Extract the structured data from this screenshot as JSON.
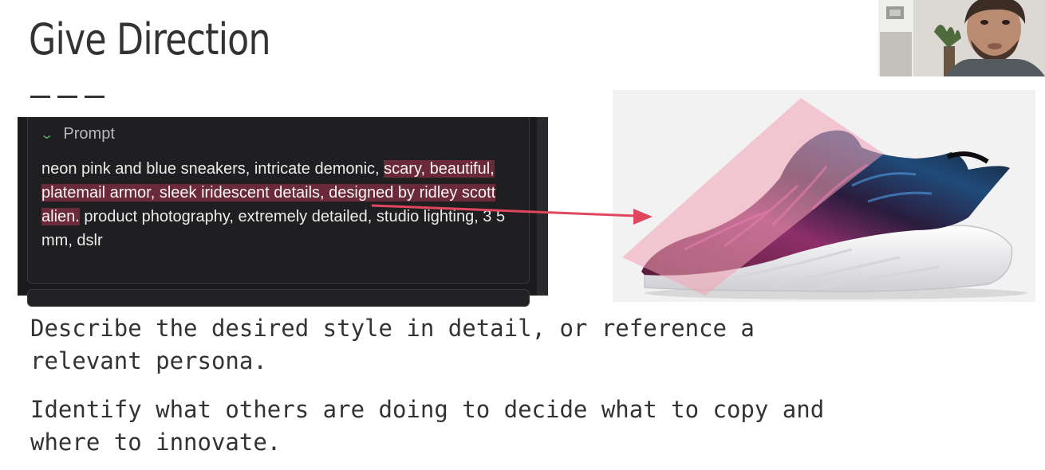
{
  "slide": {
    "title": "Give Direction"
  },
  "prompt_panel": {
    "header_label": "Prompt",
    "text_before": "neon pink and blue sneakers, intricate demonic, ",
    "text_highlighted": "scary, beautiful, platemail armor, sleek iridescent details, designed by ridley scott alien.",
    "text_after": " product photography, extremely detailed, studio lighting, 3 5 mm, dslr",
    "colors": {
      "background": "#1b1b1d",
      "highlight": "#6b2a39",
      "chevron": "#4caf6a"
    }
  },
  "annotation": {
    "arrow_color": "#e0465e",
    "overlay_color": "#f2a3b4"
  },
  "body": {
    "point1_line1": "Describe the desired style in detail, or reference a",
    "point1_line2": "relevant persona.",
    "point2_line1": "Identify what others are doing to decide what to copy and",
    "point2_line2": "where to innovate."
  }
}
